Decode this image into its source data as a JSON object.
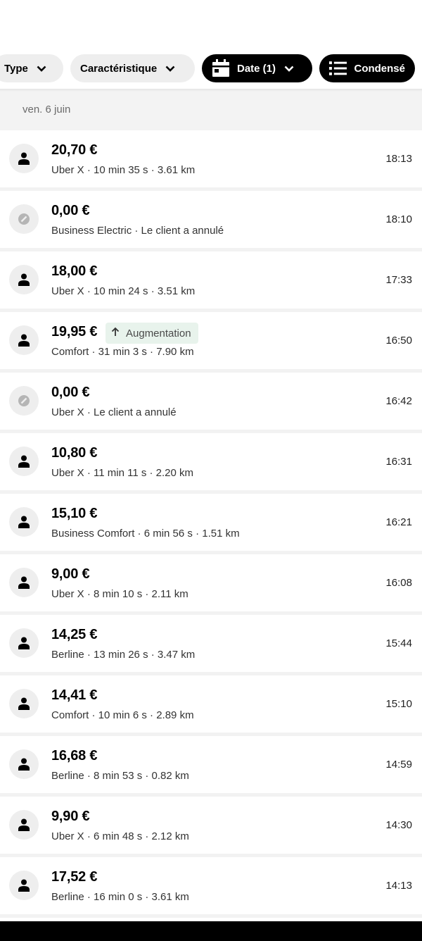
{
  "filters": {
    "type_label": "Type",
    "caracteristique_label": "Caractéristique",
    "date_label": "Date (1)",
    "condense_label": "Condensé"
  },
  "date_header": "ven. 6 juin",
  "trips": [
    {
      "price": "20,70 €",
      "details": "Uber X · 10 min 35 s · 3.61 km",
      "time": "18:13",
      "icon": "person-icon"
    },
    {
      "price": "0,00 €",
      "details": "Business Electric · Le client a annulé",
      "time": "18:10",
      "icon": "cancelled-icon"
    },
    {
      "price": "18,00 €",
      "details": "Uber X · 10 min 24 s · 3.51 km",
      "time": "17:33",
      "icon": "person-icon"
    },
    {
      "price": "19,95 €",
      "details": "Comfort · 31 min 3 s · 7.90 km",
      "time": "16:50",
      "icon": "person-icon",
      "badge": "Augmentation"
    },
    {
      "price": "0,00 €",
      "details": "Uber X · Le client a annulé",
      "time": "16:42",
      "icon": "cancelled-icon"
    },
    {
      "price": "10,80 €",
      "details": "Uber X · 11 min 11 s · 2.20 km",
      "time": "16:31",
      "icon": "person-icon"
    },
    {
      "price": "15,10 €",
      "details": "Business Comfort · 6 min 56 s · 1.51 km",
      "time": "16:21",
      "icon": "person-icon"
    },
    {
      "price": "9,00 €",
      "details": "Uber X · 8 min 10 s · 2.11 km",
      "time": "16:08",
      "icon": "person-icon"
    },
    {
      "price": "14,25 €",
      "details": "Berline · 13 min 26 s · 3.47 km",
      "time": "15:44",
      "icon": "person-icon"
    },
    {
      "price": "14,41 €",
      "details": "Comfort · 10 min 6 s · 2.89 km",
      "time": "15:10",
      "icon": "person-icon"
    },
    {
      "price": "16,68 €",
      "details": "Berline · 8 min 53 s · 0.82 km",
      "time": "14:59",
      "icon": "person-icon"
    },
    {
      "price": "9,90 €",
      "details": "Uber X · 6 min 48 s · 2.12 km",
      "time": "14:30",
      "icon": "person-icon"
    },
    {
      "price": "17,52 €",
      "details": "Berline · 16 min 0 s · 3.61 km",
      "time": "14:13",
      "icon": "person-icon"
    }
  ],
  "colors": {
    "surge_badge_bg": "#e8f3ec",
    "chip_dark": "#000000",
    "chip_light": "#eeeeee"
  }
}
